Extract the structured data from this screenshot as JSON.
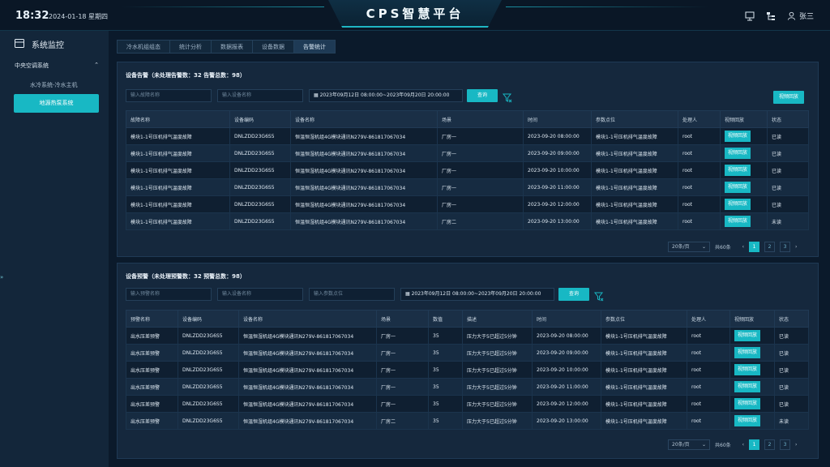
{
  "header": {
    "time": "18:32",
    "date": "2024-01-18 星期四",
    "title": "CPS智慧平台",
    "user": "张三"
  },
  "sidebar": {
    "title": "系统监控",
    "group": "中央空调系统",
    "item": "水冷系统-冷水主机",
    "active": "地源热泵系统"
  },
  "tabs": [
    "冷水机组组态",
    "统计分析",
    "数据报表",
    "设备数据",
    "告警统计"
  ],
  "alarm": {
    "title": "设备告警（未处理告警数：32 告警总数：98）",
    "fault_placeholder": "输入故障名称",
    "device_placeholder": "输入设备名称",
    "daterange": "2023年09月12日 08:00:00~2023年09月20日 20:00:00",
    "query": "查询",
    "video_btn": "视频回放",
    "columns": [
      "故障名称",
      "设备编码",
      "设备名称",
      "场景",
      "时间",
      "参数点位",
      "处理人",
      "视频回放",
      "状态"
    ],
    "rows": [
      [
        "模块1-1号压机排气温度故障",
        "DNLZDD23G6S5",
        "恒温恒湿机组4G模块通讯N279V-861817067034",
        "厂房一",
        "2023-09-20 08:00:00",
        "模块1-1号压机排气温度故障",
        "root",
        "视频回放",
        "已读"
      ],
      [
        "模块1-1号压机排气温度故障",
        "DNLZDD23G6S5",
        "恒温恒湿机组4G模块通讯N279V-861817067034",
        "厂房一",
        "2023-09-20 09:00:00",
        "模块1-1号压机排气温度故障",
        "root",
        "视频回放",
        "已读"
      ],
      [
        "模块1-1号压机排气温度故障",
        "DNLZDD23G6S5",
        "恒温恒湿机组4G模块通讯N279V-861817067034",
        "厂房一",
        "2023-09-20 10:00:00",
        "模块1-1号压机排气温度故障",
        "root",
        "视频回放",
        "已读"
      ],
      [
        "模块1-1号压机排气温度故障",
        "DNLZDD23G6S5",
        "恒温恒湿机组4G模块通讯N279V-861817067034",
        "厂房一",
        "2023-09-20 11:00:00",
        "模块1-1号压机排气温度故障",
        "root",
        "视频回放",
        "已读"
      ],
      [
        "模块1-1号压机排气温度故障",
        "DNLZDD23G6S5",
        "恒温恒湿机组4G模块通讯N279V-861817067034",
        "厂房一",
        "2023-09-20 12:00:00",
        "模块1-1号压机排气温度故障",
        "root",
        "视频回放",
        "已读"
      ],
      [
        "模块1-1号压机排气温度故障",
        "DNLZDD23G6S5",
        "恒温恒湿机组4G模块通讯N279V-861817067034",
        "厂房二",
        "2023-09-20 13:00:00",
        "模块1-1号压机排气温度故障",
        "root",
        "视频回放",
        "未读"
      ]
    ],
    "pager": {
      "size": "20条/页",
      "total": "共60条",
      "pages": [
        "1",
        "2",
        "3"
      ]
    }
  },
  "warning": {
    "title": "设备预警（未处理预警数：32 预警总数：98）",
    "warn_placeholder": "输入预警名称",
    "device_placeholder": "输入设备名称",
    "param_placeholder": "输入参数点位",
    "daterange": "2023年09月12日 08:00:00~2023年09月20日 20:00:00",
    "query": "查询",
    "columns": [
      "预警名称",
      "设备编码",
      "设备名称",
      "场景",
      "数值",
      "描述",
      "时间",
      "参数点位",
      "处理人",
      "视频回放",
      "状态"
    ],
    "rows": [
      [
        "出水压差预警",
        "DNLZDD23G6S5",
        "恒温恒湿机组4G模块通讯N279V-861817067034",
        "厂房一",
        "35",
        "压力大于5已超过5分钟",
        "2023-09-20 08:00:00",
        "模块1-1号压机排气温度故障",
        "root",
        "视频回放",
        "已读"
      ],
      [
        "出水压差预警",
        "DNLZDD23G6S5",
        "恒温恒湿机组4G模块通讯N279V-861817067034",
        "厂房一",
        "35",
        "压力大于5已超过5分钟",
        "2023-09-20 09:00:00",
        "模块1-1号压机排气温度故障",
        "root",
        "视频回放",
        "已读"
      ],
      [
        "出水压差预警",
        "DNLZDD23G6S5",
        "恒温恒湿机组4G模块通讯N279V-861817067034",
        "厂房一",
        "35",
        "压力大于5已超过5分钟",
        "2023-09-20 10:00:00",
        "模块1-1号压机排气温度故障",
        "root",
        "视频回放",
        "已读"
      ],
      [
        "出水压差预警",
        "DNLZDD23G6S5",
        "恒温恒湿机组4G模块通讯N279V-861817067034",
        "厂房一",
        "35",
        "压力大于5已超过5分钟",
        "2023-09-20 11:00:00",
        "模块1-1号压机排气温度故障",
        "root",
        "视频回放",
        "已读"
      ],
      [
        "出水压差预警",
        "DNLZDD23G6S5",
        "恒温恒湿机组4G模块通讯N279V-861817067034",
        "厂房一",
        "35",
        "压力大于5已超过5分钟",
        "2023-09-20 12:00:00",
        "模块1-1号压机排气温度故障",
        "root",
        "视频回放",
        "已读"
      ],
      [
        "出水压差预警",
        "DNLZDD23G6S5",
        "恒温恒湿机组4G模块通讯N279V-861817067034",
        "厂房二",
        "35",
        "压力大于5已超过5分钟",
        "2023-09-20 13:00:00",
        "模块1-1号压机排气温度故障",
        "root",
        "视频回放",
        "未读"
      ]
    ],
    "pager": {
      "size": "20条/页",
      "total": "共60条",
      "pages": [
        "1",
        "2",
        "3"
      ]
    }
  },
  "colors": {
    "accent": "#18b8c4",
    "background": "#0b1a2b",
    "panel": "#15283d"
  }
}
